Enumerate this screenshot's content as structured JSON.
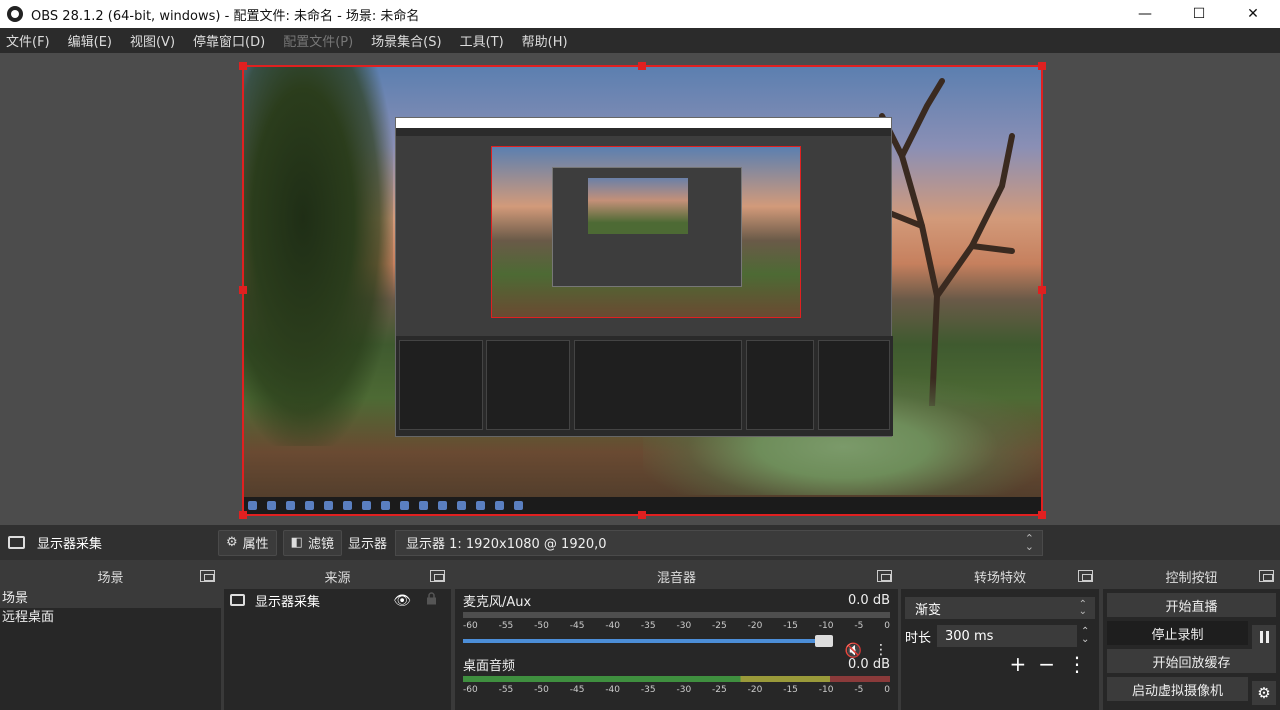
{
  "window": {
    "title": "OBS 28.1.2 (64-bit, windows) - 配置文件: 未命名 - 场景: 未命名",
    "minimize": "—",
    "maximize": "☐",
    "close": "✕"
  },
  "menu": [
    "文件(F)",
    "编辑(E)",
    "视图(V)",
    "停靠窗口(D)",
    "配置文件(P)",
    "场景集合(S)",
    "工具(T)",
    "帮助(H)"
  ],
  "source_toolbar": {
    "selected_source": "显示器采集",
    "properties_label": "属性",
    "filters_label": "滤镜",
    "display_label": "显示器",
    "display_value": "显示器 1: 1920x1080 @ 1920,0"
  },
  "scenes": {
    "header": "场景",
    "items": [
      "场景",
      "远程桌面"
    ]
  },
  "sources": {
    "header": "来源",
    "items": [
      "显示器采集"
    ]
  },
  "mixer": {
    "header": "混音器",
    "channels": [
      {
        "name": "麦克风/Aux",
        "level": "0.0 dB",
        "muted": true,
        "volume": 1.0
      },
      {
        "name": "桌面音频",
        "level": "0.0 dB",
        "muted": false,
        "volume": 1.0
      }
    ],
    "ticks": [
      "-60",
      "-55",
      "-50",
      "-45",
      "-40",
      "-35",
      "-30",
      "-25",
      "-20",
      "-15",
      "-10",
      "-5",
      "0"
    ]
  },
  "transitions": {
    "header": "转场特效",
    "type": "渐变",
    "duration_label": "时长",
    "duration_value": "300 ms",
    "add": "+",
    "remove": "−",
    "more": "⋮"
  },
  "controls": {
    "header": "控制按钮",
    "start_stream": "开始直播",
    "stop_record": "停止录制",
    "start_replay": "开始回放缓存",
    "start_virtualcam": "启动虚拟摄像机"
  },
  "colors": {
    "selection_border": "#e02020",
    "slider": "#4c8ed8",
    "mute": "#e03030"
  }
}
